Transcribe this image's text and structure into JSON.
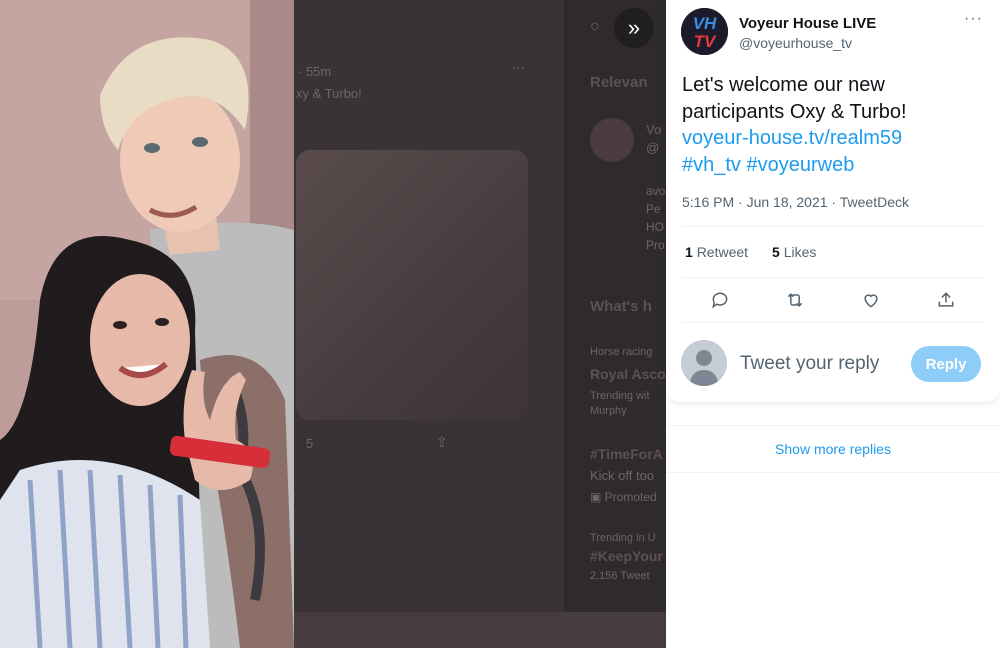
{
  "tweet": {
    "author_name": "Voyeur House LIVE",
    "author_handle": "@voyeurhouse_tv",
    "avatar_text_top": "VH",
    "avatar_text_bottom": "TV",
    "text": "Let's welcome our new participants Oxy & Turbo!",
    "link": "voyeur-house.tv/realm59",
    "hashtag_1": "#vh_tv",
    "hashtag_2": "#voyeurweb",
    "timestamp": "5:16 PM · Jun 18, 2021 · TweetDeck",
    "retweet_count": "1",
    "retweet_label": "Retweet",
    "like_count": "5",
    "like_label": "Likes",
    "more_label": "···"
  },
  "reply": {
    "placeholder": "Tweet your reply",
    "button_label": "Reply"
  },
  "show_more_label": "Show more replies",
  "expand_icon": "»",
  "background": {
    "time": "· 55m",
    "snippet": "xy & Turbo!",
    "relevant": "Relevan",
    "whats": "What's h",
    "trend_1_category": "Horse racing",
    "trend_1_title": "Royal Asco",
    "trend_1_sub": "Trending wit",
    "trend_1_sub2": "Murphy",
    "trend_2_title": "#TimeForA",
    "trend_2_sub": "Kick off too",
    "trend_2_promoted": "Promoted",
    "trend_3_category": "Trending in U",
    "trend_3_title": "#KeepYour",
    "trend_3_count": "2,156 Tweet",
    "like_count": "5",
    "ghost_lines": [
      "avo",
      "Pe",
      "HO",
      "Pro"
    ]
  },
  "colors": {
    "accent": "#1d9bf0",
    "reply_button": "#8ecdf8",
    "text_primary": "#0f1419",
    "text_secondary": "#536471"
  }
}
